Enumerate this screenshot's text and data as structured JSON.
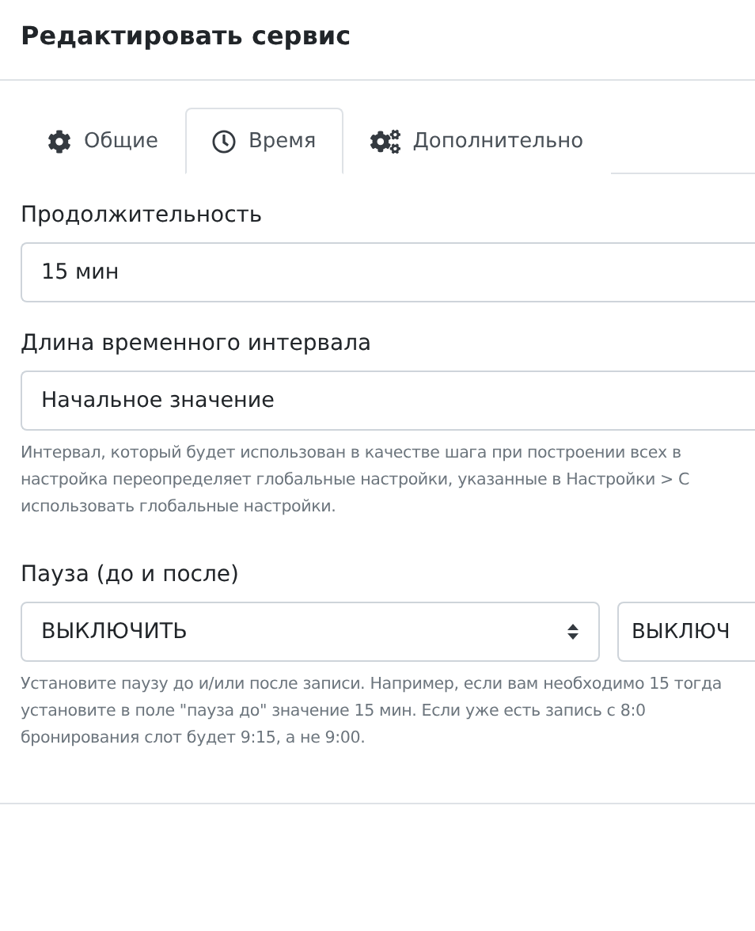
{
  "title": "Редактировать сервис",
  "tabs": [
    {
      "label": "Общие",
      "selected": false
    },
    {
      "label": "Время",
      "selected": true
    },
    {
      "label": "Дополнительно",
      "selected": false
    }
  ],
  "duration": {
    "label": "Продолжительность",
    "value": "15 мин"
  },
  "interval": {
    "label": "Длина временного интервала",
    "value": "Начальное значение",
    "help": "Интервал, который будет использован в качестве шага при построении всех в настройка переопределяет глобальные настройки, указанные в Настройки > С использовать глобальные настройки."
  },
  "pause": {
    "label": "Пауза (до и после)",
    "before": "ВЫКЛЮЧИТЬ",
    "after": "ВЫКЛЮЧ",
    "help": "Установите паузу до и/или после записи. Например, если вам необходимо 15 тогда установите в поле \"пауза до\" значение 15 мин. Если уже есть запись с 8:0 бронирования слот будет 9:15, а не 9:00."
  }
}
